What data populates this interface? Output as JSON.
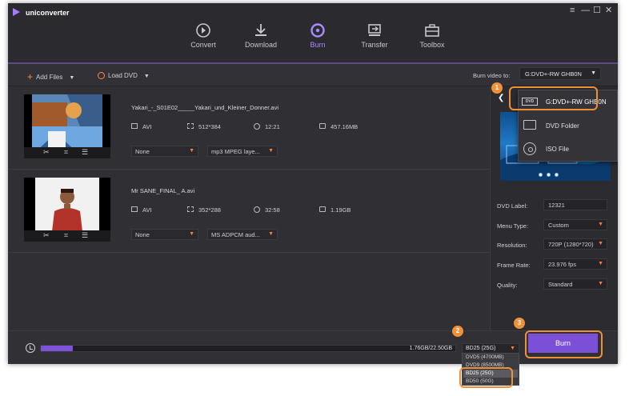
{
  "app": {
    "title": "uniconverter",
    "window_controls": [
      "≡",
      "—",
      "☐",
      "✕"
    ]
  },
  "nav": {
    "tabs": [
      {
        "label": "Convert",
        "icon": "convert-icon"
      },
      {
        "label": "Download",
        "icon": "download-icon"
      },
      {
        "label": "Burn",
        "icon": "burn-icon",
        "active": true
      },
      {
        "label": "Transfer",
        "icon": "transfer-icon"
      },
      {
        "label": "Toolbox",
        "icon": "toolbox-icon"
      }
    ]
  },
  "toolbar": {
    "add_files": "Add Files",
    "load_dvd": "Load DVD",
    "burn_to_label": "Burn video to:",
    "burn_to_value": "G:DVD+-RW GHB0N"
  },
  "files": [
    {
      "name": "Yakari_-_S01E02_____Yakari_und_Kleiner_Donner.avi",
      "format": "AVI",
      "resolution": "512*384",
      "duration": "12:21",
      "size": "457.16MB",
      "subtitle": "None",
      "audio": "mp3 MPEG laye..."
    },
    {
      "name": "Mr SANE_FINAL_ A.avi",
      "format": "AVI",
      "resolution": "352*288",
      "duration": "32:58",
      "size": "1.19GB",
      "subtitle": "None",
      "audio": "MS ADPCM aud..."
    }
  ],
  "burn_targets": [
    {
      "label": "G:DVD+-RW GHB0N",
      "icon": "dvd-drive-icon",
      "selected": true
    },
    {
      "label": "DVD Folder",
      "icon": "folder-icon"
    },
    {
      "label": "ISO File",
      "icon": "iso-disc-icon"
    }
  ],
  "settings": {
    "dvd_label": {
      "label": "DVD Label:",
      "value": "12321"
    },
    "menu_type": {
      "label": "Menu Type:",
      "value": "Custom"
    },
    "resolution": {
      "label": "Resolution:",
      "value": "720P (1280*720)"
    },
    "frame_rate": {
      "label": "Frame Rate:",
      "value": "23.976 fps"
    },
    "quality": {
      "label": "Quality:",
      "value": "Standard"
    }
  },
  "bottom": {
    "progress_text": "1.76GB/22.50GB",
    "progress_fraction": 0.078,
    "disc_type": "BD25 (25G)",
    "disc_options": [
      "DVD5 (4700MB)",
      "DVD9 (8500MB)",
      "BD25 (25G)",
      "BD50 (50G)"
    ],
    "burn_button": "Burn"
  },
  "annotations": [
    "1",
    "2",
    "3"
  ],
  "colors": {
    "accent": "#7b4fd6",
    "highlight": "#f0913a",
    "background": "#2c2c31"
  }
}
